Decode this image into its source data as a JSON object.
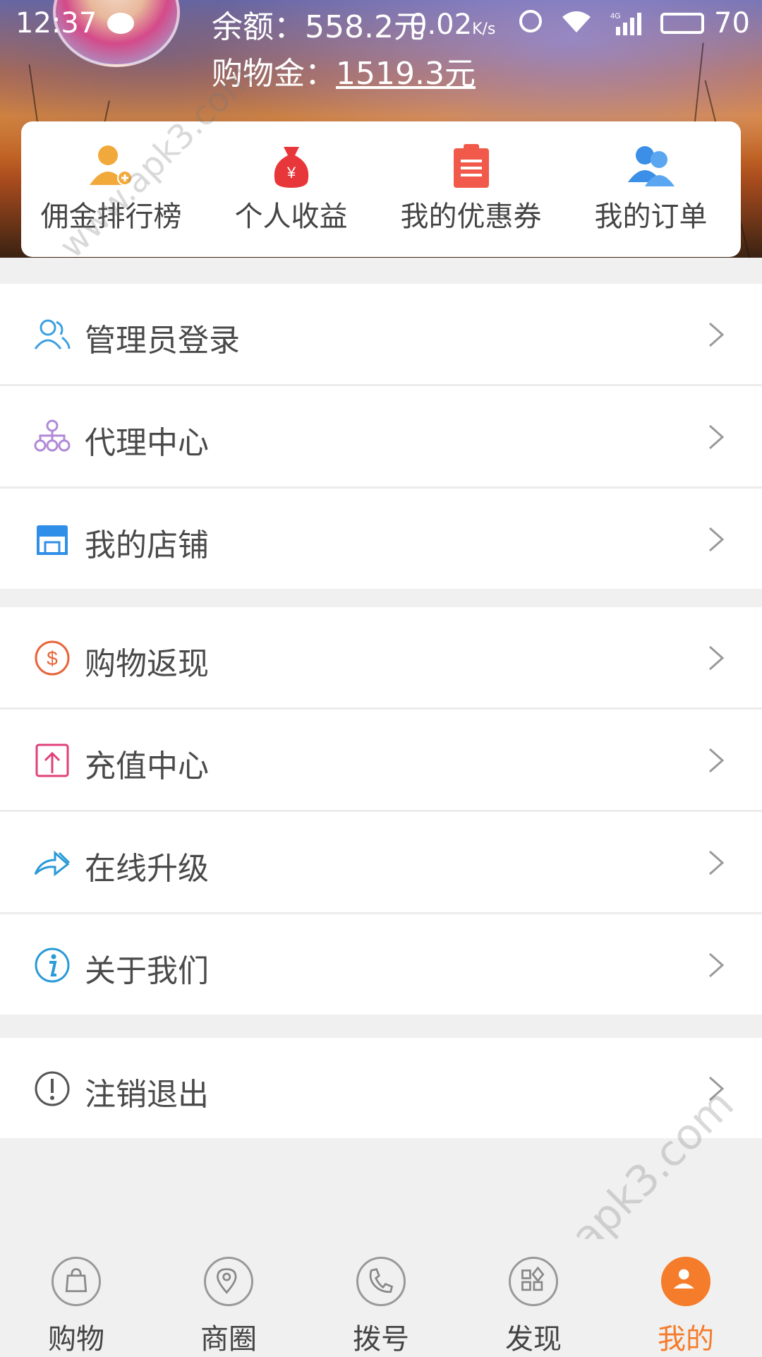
{
  "status_bar": {
    "time": "12:37",
    "net_speed": "0.02",
    "net_speed_unit": "K/s",
    "network": "4G",
    "battery": "70"
  },
  "profile": {
    "balance": "余额：558.2元",
    "shopping_gold_label": "购物金：",
    "shopping_gold_value": "1519.3元"
  },
  "quick_actions": [
    {
      "label": "佣金排行榜",
      "icon": "user-add-icon",
      "color": "#f2a93b"
    },
    {
      "label": "个人收益",
      "icon": "money-bag-icon",
      "color": "#e8373a"
    },
    {
      "label": "我的优惠券",
      "icon": "clipboard-icon",
      "color": "#f15a4a"
    },
    {
      "label": "我的订单",
      "icon": "users-icon",
      "color": "#3b8fe6"
    }
  ],
  "menu_sections": [
    [
      {
        "label": "管理员登录",
        "icon": "admin-icon"
      },
      {
        "label": "代理中心",
        "icon": "org-chart-icon"
      },
      {
        "label": "我的店铺",
        "icon": "store-icon"
      }
    ],
    [
      {
        "label": "购物返现",
        "icon": "dollar-icon"
      },
      {
        "label": "充值中心",
        "icon": "upload-icon"
      },
      {
        "label": "在线升级",
        "icon": "forward-icon"
      },
      {
        "label": "关于我们",
        "icon": "info-icon"
      }
    ],
    [
      {
        "label": "注销退出",
        "icon": "alert-icon"
      }
    ]
  ],
  "tabbar": [
    {
      "label": "购物",
      "icon": "shopping-bag-icon"
    },
    {
      "label": "商圈",
      "icon": "location-pin-icon"
    },
    {
      "label": "拨号",
      "icon": "phone-icon"
    },
    {
      "label": "发现",
      "icon": "discover-icon"
    },
    {
      "label": "我的",
      "icon": "person-icon",
      "active": true
    }
  ],
  "watermark": "www.apk3.com",
  "colors": {
    "accent": "#f57c2a",
    "divider": "#ececec",
    "background": "#f0f0f0"
  }
}
